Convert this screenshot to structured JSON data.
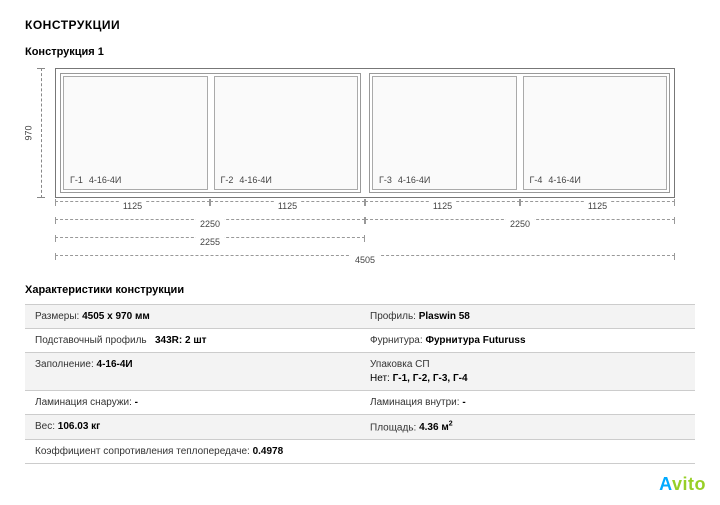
{
  "title": "КОНСТРУКЦИИ",
  "construction_label": "Конструкция 1",
  "height_dim": "970",
  "sashes": [
    {
      "code": "Г-1",
      "glass": "4-16-4И"
    },
    {
      "code": "Г-2",
      "glass": "4-16-4И"
    },
    {
      "code": "Г-3",
      "glass": "4-16-4И"
    },
    {
      "code": "Г-4",
      "glass": "4-16-4И"
    }
  ],
  "dim_rows": {
    "r1": [
      "1125",
      "1125",
      "1125",
      "1125"
    ],
    "r2": [
      "2250",
      "2250"
    ],
    "r3_left": "2255",
    "r4": "4505"
  },
  "spec_heading": "Характеристики конструкции",
  "spec": {
    "size_lbl": "Размеры:",
    "size_val": "4505 x 970 мм",
    "profile_lbl": "Профиль:",
    "profile_val": "Plaswin 58",
    "base_lbl": "Подставочный профиль",
    "base_val": "343R: 2 шт",
    "hardware_lbl": "Фурнитура:",
    "hardware_val": "Фурнитура Futuruss",
    "fill_lbl": "Заполнение:",
    "fill_val": "4-16-4И",
    "pack_line1": "Упаковка СП",
    "pack_line2_lbl": "Нет:",
    "pack_line2_val": "Г-1, Г-2, Г-3, Г-4",
    "lam_out_lbl": "Ламинация снаружи:",
    "lam_out_val": "-",
    "lam_in_lbl": "Ламинация внутри:",
    "lam_in_val": "-",
    "weight_lbl": "Вес:",
    "weight_val": "106.03 кг",
    "area_lbl": "Площадь:",
    "area_val": "4.36 м",
    "area_unit_sup": "2",
    "coef_lbl": "Коэффициент сопротивления теплопередаче:",
    "coef_val": "0.4978"
  },
  "watermark": {
    "a": "A",
    "v": "vito"
  }
}
